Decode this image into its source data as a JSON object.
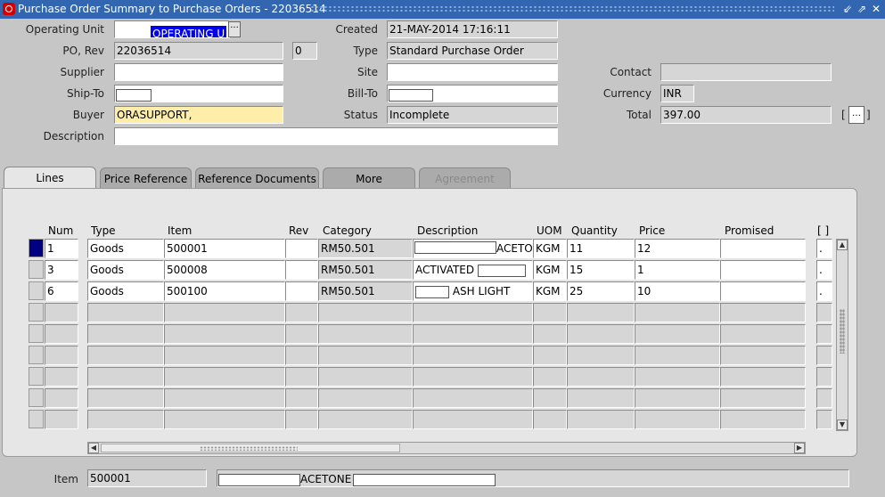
{
  "window": {
    "title": "Purchase Order Summary to Purchase Orders - 22036514"
  },
  "header": {
    "operating_unit_label": "Operating Unit",
    "operating_unit_value": "OPERATING U",
    "created_label": "Created",
    "created_value": "21-MAY-2014 17:16:11",
    "po_rev_label": "PO, Rev",
    "po_value": "22036514",
    "rev_value": "0",
    "type_label": "Type",
    "type_value": "Standard Purchase Order",
    "supplier_label": "Supplier",
    "supplier_value": "",
    "site_label": "Site",
    "site_value": "",
    "contact_label": "Contact",
    "contact_value": "",
    "shipto_label": "Ship-To",
    "billto_label": "Bill-To",
    "currency_label": "Currency",
    "currency_value": "INR",
    "buyer_label": "Buyer",
    "buyer_value": "ORASUPPORT,",
    "status_label": "Status",
    "status_value": "Incomplete",
    "total_label": "Total",
    "total_value": "397.00",
    "total_bracket_open": "[",
    "total_bracket_close": "]",
    "description_label": "Description",
    "description_value": ""
  },
  "tabs": [
    "Lines",
    "Price Reference",
    "Reference Documents",
    "More",
    "Agreement"
  ],
  "lines": {
    "columns": [
      "Num",
      "Type",
      "Item",
      "Rev",
      "Category",
      "Description",
      "UOM",
      "Quantity",
      "Price",
      "Promised",
      "[ ]"
    ],
    "rows": [
      {
        "num": "1",
        "type": "Goods",
        "item": "500001",
        "rev": "",
        "category": "RM50.501",
        "description": "ACETONE",
        "uom": "KGM",
        "quantity": "11",
        "price": "12",
        "promised": ""
      },
      {
        "num": "3",
        "type": "Goods",
        "item": "500008",
        "rev": "",
        "category": "RM50.501",
        "description": "ACTIVATED",
        "uom": "KGM",
        "quantity": "15",
        "price": "1",
        "promised": ""
      },
      {
        "num": "6",
        "type": "Goods",
        "item": "500100",
        "rev": "",
        "category": "RM50.501",
        "description": "ASH LIGHT",
        "uom": "KGM",
        "quantity": "25",
        "price": "10",
        "promised": ""
      }
    ],
    "dot": "."
  },
  "footer": {
    "item_label": "Item",
    "item_value": "500001",
    "item_description": "ACETONE"
  }
}
